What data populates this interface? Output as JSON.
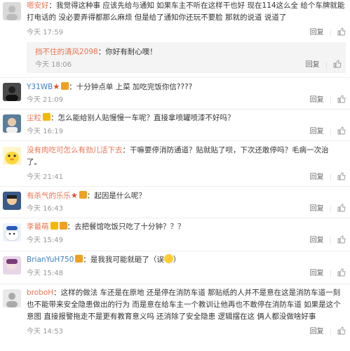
{
  "comments": [
    {
      "user": "嗯安好",
      "text_l1": "：我觉得这种事 应该先给与通知 如果车主不听在这样干也好 现在114这么全 给个车牌就能",
      "text_l2": "打电话的 没必要弄得都那么麻烦 但是给了通知你还玩不要脸 那就的说道 说道了",
      "time": "今天 17:59",
      "reply_label": "回复",
      "like_label": "赞"
    },
    {
      "user": "挡不住的清风2098",
      "text": "：你好有耐心噢！",
      "time": "今天 18:06",
      "reply_label": "回复",
      "like_label": "赞"
    },
    {
      "user": "Y31WB",
      "text": "：十分钟点单 上菜 加吃完饭你信????",
      "time": "今天 21:09",
      "reply_label": "回复",
      "like_label": "赞"
    },
    {
      "user": "尘粒",
      "text": "：怎么能给别人贴慢慢一车呢？直接拿喷罐喷漆不好吗？",
      "time": "今天 16:19",
      "reply_label": "回复",
      "like_label": "赞"
    },
    {
      "user": "没有肉吃可怎么有劲儿活下去",
      "text_l1": "：干嘛要停消防通道？贴就贴了呗，下次还敢停吗？毛病一次治",
      "text_l2": "了。",
      "time": "今天 21:41",
      "reply_label": "回复",
      "like_label": "赞"
    },
    {
      "user": "有杀气的乐乐",
      "text": "：起因是什么呢？",
      "time": "今天 16:43",
      "reply_label": "回复",
      "like_label": "赞"
    },
    {
      "user": "李最萌",
      "text": "：去把餐馆吃饭只吃了十分钟？？？",
      "time": "今天 15:49",
      "reply_label": "回复",
      "like_label": "赞"
    },
    {
      "user": "BrianYuH750",
      "text": "：是我我可能就砸了（误",
      "text_end": "）",
      "time": "今天 15:48",
      "reply_label": "回复",
      "like_label": "赞"
    },
    {
      "user": "broboH",
      "text_l1": "：这样的做法  车还是在原地  还是停在消防车道  那贴纸的人并不是意在这是消防车道一刻",
      "text_l2": "也不能带来安全隐患做出的行为  而是意在给车主一个教训让他再也不敢停在消防车道  如果是这个",
      "text_l3": "意图  直接报警拖走不是更有教育意义吗  还消除了安全隐患  逻辑摆在这  俩人都没做啥好事",
      "time": "今天 14:53",
      "reply_label": "回复",
      "like_label": "赞"
    }
  ],
  "colors": {
    "username": "#eb7350",
    "username_alt": "#3b7fc4",
    "meta": "#999999",
    "reply_bg": "#f4f4f4"
  }
}
